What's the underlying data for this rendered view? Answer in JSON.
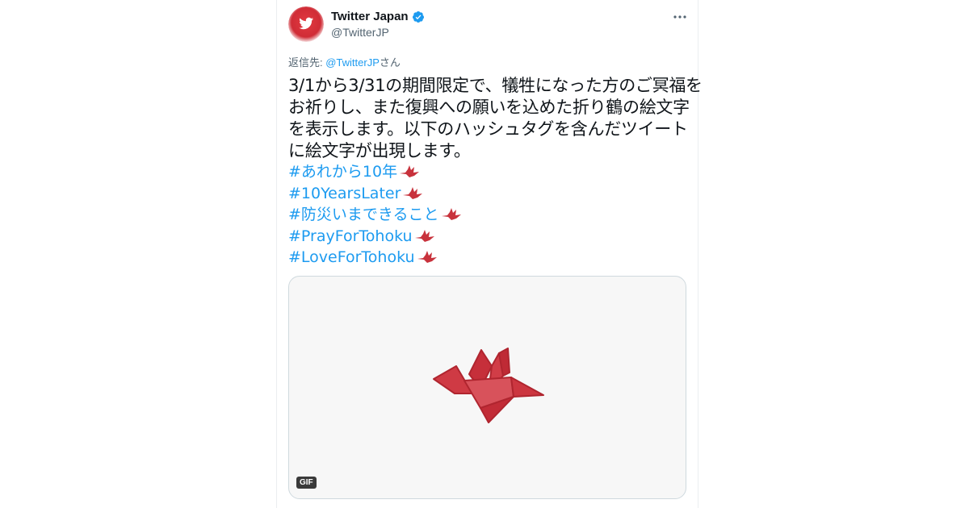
{
  "tweet": {
    "author_name": "Twitter Japan",
    "handle": "@TwitterJP",
    "reply_prefix": "返信先: ",
    "reply_mention": "@TwitterJP",
    "reply_suffix": "さん",
    "text_lines": [
      "3/1から3/31の期間限定で、犠牲になった方のご冥福を",
      "お祈りし、また復興への願いを込めた折り鶴の絵文字",
      "を表示します。以下のハッシュタグを含んだツイート",
      "に絵文字が出現します。"
    ],
    "hashtags": [
      "#あれから10年",
      "#10YearsLater",
      "#防災いまできること",
      "#PrayForTohoku",
      "#LoveForTohoku"
    ],
    "media": {
      "badge": "GIF"
    }
  },
  "icons": {
    "avatar": "twitter-bird-logo",
    "verified": "verified-badge-icon",
    "more": "more-dots-icon",
    "emoji": "paper-crane-emoji"
  },
  "colors": {
    "accent": "#1d9bf0",
    "crane": "#c8323c",
    "avatar_bg": "#d8343c"
  }
}
